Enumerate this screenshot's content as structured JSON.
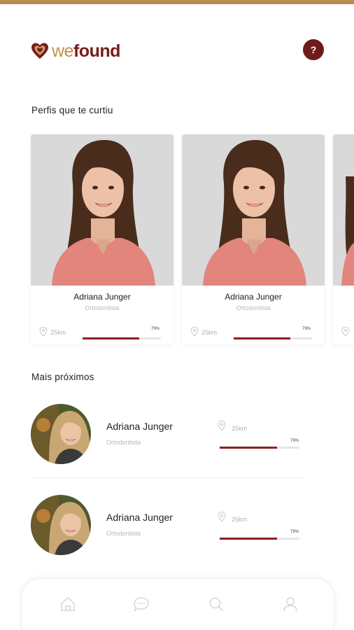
{
  "brand": {
    "part1": "we",
    "part2": "found"
  },
  "header": {
    "help_label": "?"
  },
  "liked": {
    "title": "Perfis que te curtiu",
    "cards": [
      {
        "name": "Adriana Junger",
        "job": "Ortodontista",
        "distance": "25km",
        "match": "79%",
        "match_value": 0.72
      },
      {
        "name": "Adriana Junger",
        "job": "Ortodontista",
        "distance": "25km",
        "match": "79%",
        "match_value": 0.72
      }
    ]
  },
  "nearby": {
    "title": "Mais próximos",
    "items": [
      {
        "name": "Adriana Junger",
        "job": "Ortodontista",
        "distance": "25km",
        "match": "79%",
        "match_value": 0.72
      },
      {
        "name": "Adriana Junger",
        "job": "Ortodontista",
        "distance": "25km",
        "match": "79%",
        "match_value": 0.72
      }
    ]
  },
  "colors": {
    "brand_dark": "#6f1b1b",
    "brand_gold": "#c09050",
    "progress": "#8e1e1e"
  },
  "nav": {
    "icons": [
      "home-icon",
      "chat-icon",
      "search-icon",
      "profile-icon"
    ]
  }
}
